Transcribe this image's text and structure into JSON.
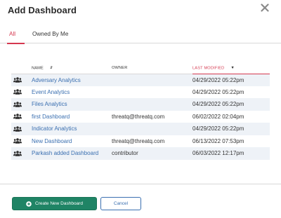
{
  "dialog": {
    "title": "Add Dashboard"
  },
  "tabs": [
    {
      "label": "All",
      "active": true
    },
    {
      "label": "Owned By Me",
      "active": false
    }
  ],
  "table": {
    "columns": [
      {
        "key": "name",
        "label": "NAME",
        "sort": "unsorted"
      },
      {
        "key": "owner",
        "label": "OWNER",
        "sort": "none"
      },
      {
        "key": "last_modified",
        "label": "LAST MODIFIED",
        "sort": "descending"
      }
    ],
    "rows": [
      {
        "icon": "users-icon",
        "name": "Adversary Analytics",
        "owner": "",
        "last_modified": "04/29/2022 05:22pm"
      },
      {
        "icon": "users-icon",
        "name": "Event Analytics",
        "owner": "",
        "last_modified": "04/29/2022 05:22pm"
      },
      {
        "icon": "users-icon",
        "name": "Files Analytics",
        "owner": "",
        "last_modified": "04/29/2022 05:22pm"
      },
      {
        "icon": "users-icon",
        "name": "first Dashboard",
        "owner": "threatq@threatq.com",
        "last_modified": "06/02/2022 02:04pm"
      },
      {
        "icon": "users-icon",
        "name": "Indicator Analytics",
        "owner": "",
        "last_modified": "04/29/2022 05:22pm"
      },
      {
        "icon": "users-icon",
        "name": "New Dashboard",
        "owner": "threatq@threatq.com",
        "last_modified": "06/13/2022 07:53pm"
      },
      {
        "icon": "users-icon",
        "name": "Parkash added Dashboard",
        "owner": "contributor",
        "last_modified": "06/03/2022 12:17pm"
      }
    ]
  },
  "footer": {
    "create_label": "Create New Dashboard",
    "cancel_label": "Cancel"
  },
  "colors": {
    "accent": "#d5384f",
    "link": "#3a6fb0",
    "primary_button": "#1f8465",
    "row_stripe": "#eef2f7"
  }
}
